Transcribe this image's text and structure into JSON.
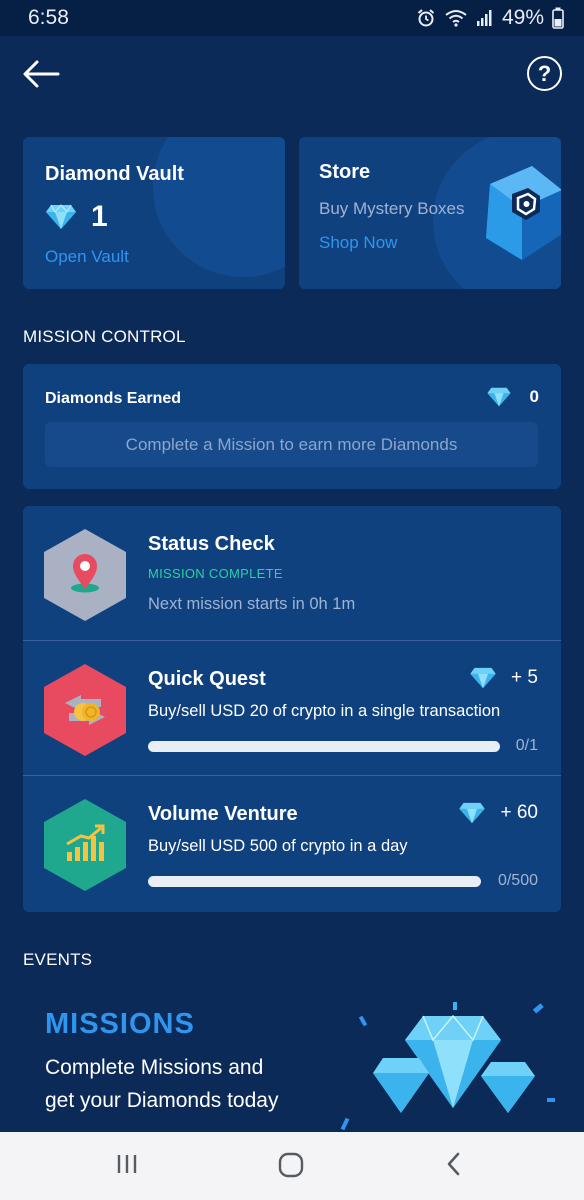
{
  "status_bar": {
    "time": "6:58",
    "battery": "49%",
    "icons": [
      "alarm-icon",
      "wifi-icon",
      "signal-icon",
      "battery-icon"
    ]
  },
  "top_nav": {
    "back_icon": "arrow-left-icon",
    "help_label": "?"
  },
  "vault": {
    "title": "Diamond Vault",
    "count": "1",
    "link": "Open Vault"
  },
  "store": {
    "title": "Store",
    "subtitle": "Buy Mystery Boxes",
    "link": "Shop Now"
  },
  "mission_control": {
    "section_title": "MISSION CONTROL",
    "earned_title": "Diamonds Earned",
    "earned_value": "0",
    "hint": "Complete a Mission to earn more Diamonds"
  },
  "missions": [
    {
      "title": "Status Check",
      "status": "MISSION COMPLETE",
      "description": "Next mission starts in 0h 1m",
      "icon": "location-pin-icon",
      "hex_color": "#a9b1c2"
    },
    {
      "title": "Quick Quest",
      "reward": "+ 5",
      "description": "Buy/sell USD 20 of crypto in a single transaction",
      "progress_text": "0/1",
      "progress": 0,
      "icon": "exchange-coins-icon",
      "hex_color": "#e84a5f"
    },
    {
      "title": "Volume Venture",
      "reward": "+ 60",
      "description": "Buy/sell USD 500 of crypto in a day",
      "progress_text": "0/500",
      "progress": 0,
      "icon": "growth-chart-icon",
      "hex_color": "#1fa88e"
    }
  ],
  "events": {
    "section_title": "EVENTS",
    "banner_heading": "MISSIONS",
    "banner_line1": "Complete Missions and",
    "banner_line2": "get your Diamonds today"
  },
  "colors": {
    "background": "#0b2a58",
    "card": "#10417f",
    "accent": "#2f95ee",
    "success": "#2bd0a1"
  }
}
